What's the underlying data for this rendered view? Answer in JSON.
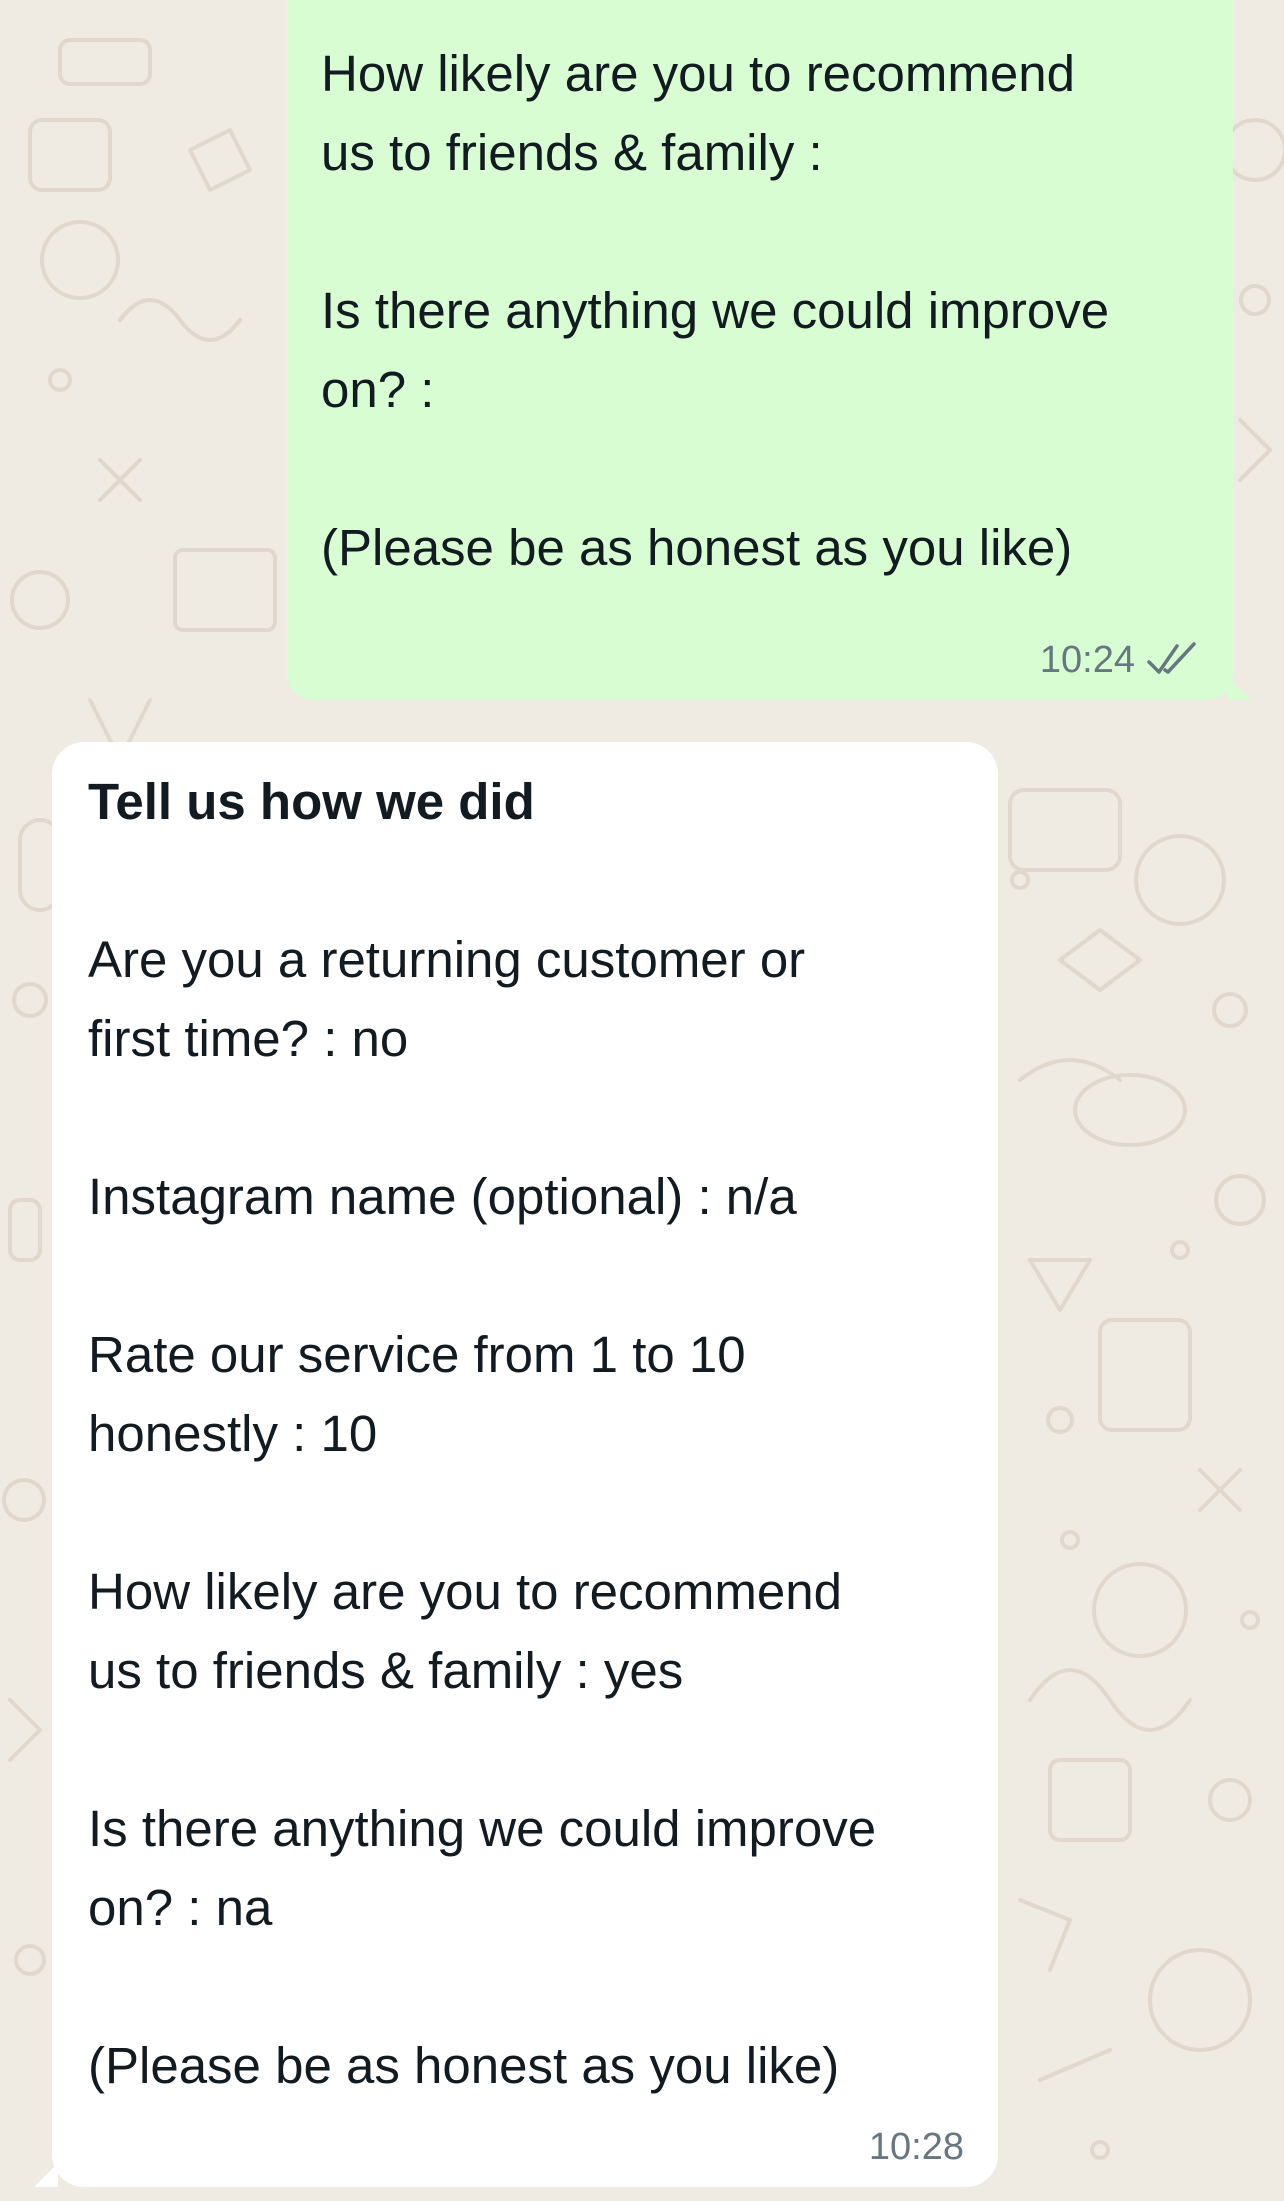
{
  "colors": {
    "background": "#efeae2",
    "outgoing_bubble": "#d9fdd3",
    "incoming_bubble": "#ffffff",
    "meta_text": "#667781",
    "ticks": "#667781"
  },
  "messages": {
    "outgoing": {
      "line1": "How likely are you to recommend",
      "line2": "us to friends & family :",
      "line3": "Is there anything we could improve",
      "line4": "on? :",
      "line5": "(Please be as honest as you like)",
      "time": "10:24",
      "status_icon": "double-tick-icon"
    },
    "incoming": {
      "title": "Tell us how we did",
      "line1": "Are you a returning customer or",
      "line2": "first time? : no",
      "line3": "Instagram name (optional) : n/a",
      "line4": "Rate our service from 1 to 10",
      "line5": "honestly : 10",
      "line6": "How likely are you to recommend",
      "line7": "us to friends & family : yes",
      "line8": "Is there anything we could improve",
      "line9": "on? : na",
      "line10": "(Please be as honest as you like)",
      "time": "10:28"
    }
  }
}
